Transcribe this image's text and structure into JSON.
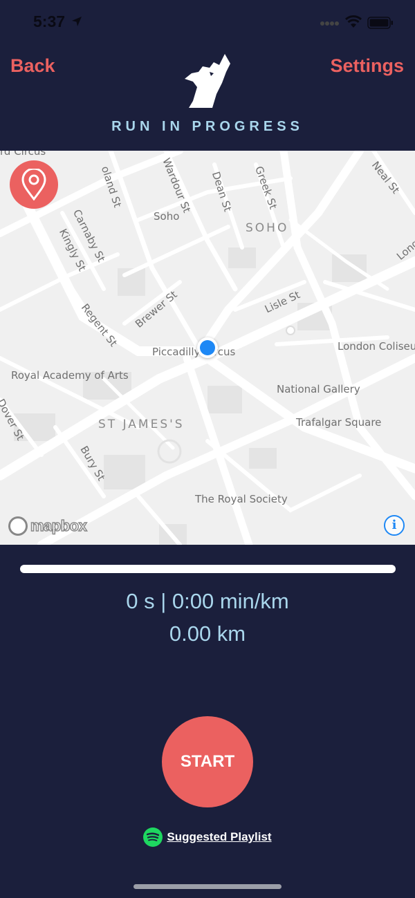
{
  "status_bar": {
    "time": "5:37"
  },
  "header": {
    "back_label": "Back",
    "settings_label": "Settings",
    "title": "RUN IN PROGRESS",
    "logo_icon": "wolf-howling-icon"
  },
  "map": {
    "attribution": "mapbox",
    "labels": {
      "circus_top": "rd Circus",
      "poland_st": "oland St",
      "wardour_st": "Wardour St",
      "dean_st": "Dean St",
      "greek_st": "Greek St",
      "neal_st": "Neal St",
      "soho": "Soho",
      "soho_district": "SOHO",
      "carnaby_st": "Carnaby St",
      "kingly_st": "Kingly St",
      "long": "Long",
      "brewer_st": "Brewer St",
      "lisle_st": "Lisle St",
      "regent_st": "Regent St",
      "piccadilly": "Piccadilly Circus",
      "london_coliseum": "London Coliseu",
      "royal_academy": "Royal Academy of Arts",
      "national_gallery": "National Gallery",
      "dover_st": "Dover St",
      "st_james": "ST JAMES'S",
      "trafalgar": "Trafalgar Square",
      "bury_st": "Bury St",
      "royal_society": "The Royal Society"
    }
  },
  "run": {
    "progress_fraction": 0,
    "time_pace": "0 s | 0:00 min/km",
    "distance": "0.00 km"
  },
  "start_label": "START",
  "playlist_label": "Suggested Playlist",
  "colors": {
    "background": "#1b1f3c",
    "accent": "#eb6160",
    "text_light_blue": "#a9d6ec",
    "spotify_green": "#1ed760",
    "location_blue": "#1e88f5"
  }
}
